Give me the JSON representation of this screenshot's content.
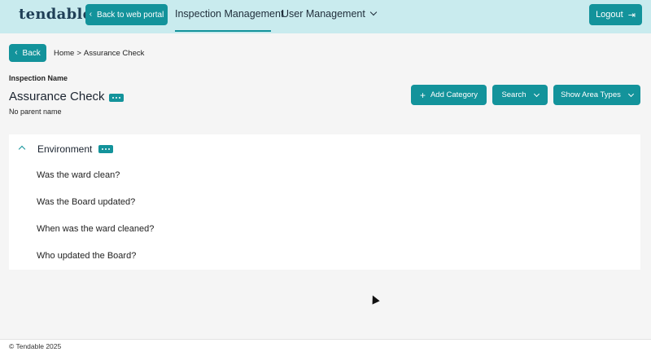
{
  "header": {
    "logo": "tendable",
    "back_to_portal": "Back to web portal",
    "tabs": [
      {
        "label": "Inspection Management"
      },
      {
        "label": "User Management"
      }
    ],
    "logout": "Logout"
  },
  "subnav": {
    "back": "Back",
    "breadcrumb": [
      "Home",
      ">",
      "Assurance Check"
    ]
  },
  "inspection": {
    "label": "Inspection Name",
    "title": "Assurance Check",
    "parent": "No parent name"
  },
  "actions": {
    "add_category": "Add Category",
    "search": "Search",
    "show_area_types": "Show Area Types"
  },
  "category": {
    "name": "Environment",
    "questions": [
      "Was the ward clean?",
      "Was the Board updated?",
      "When was the ward cleaned?",
      "Who updated the Board?"
    ]
  },
  "footer": {
    "copyright": "© Tendable 2025"
  },
  "colors": {
    "accent": "#13939b",
    "header_bg": "#c9ebee"
  }
}
